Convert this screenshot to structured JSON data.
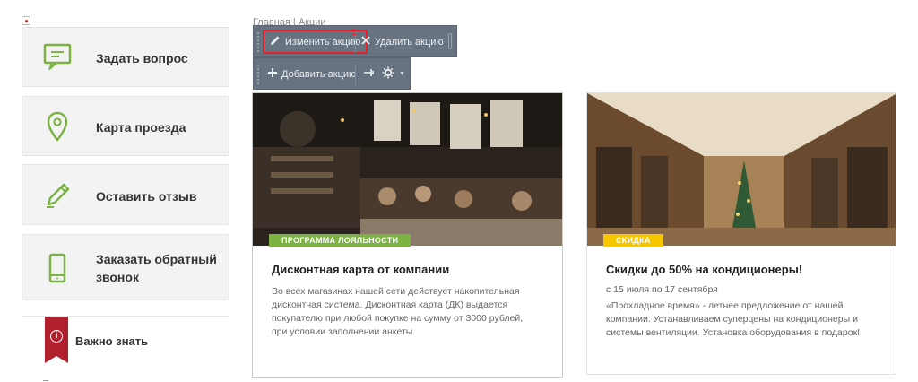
{
  "breadcrumb": "Главная | Акции",
  "sidebar": {
    "items": [
      {
        "label": "Задать вопрос",
        "icon": "chat-bubble-icon"
      },
      {
        "label": "Карта проезда",
        "icon": "map-pin-icon"
      },
      {
        "label": "Оставить отзыв",
        "icon": "pencil-icon"
      },
      {
        "label": "Заказать обратный звонок",
        "icon": "phone-icon"
      }
    ],
    "important_label": "Важно знать",
    "icon_color": "#7cb342",
    "ribbon_color": "#b21f2d"
  },
  "toolbar": {
    "edit_label": "Изменить акцию",
    "delete_label": "Удалить акцию",
    "add_label": "Добавить акцию",
    "marker": "1"
  },
  "cards": [
    {
      "tag": "ПРОГРАММА ЛОЯЛЬНОСТИ",
      "tag_color": "#7cb342",
      "title": "Дисконтная карта от компании",
      "text": "Во всех магазинах нашей сети действует накопительная дисконтная система. Дисконтная карта (ДК) выдается покупателю при любой покупке на сумму от 3000 рублей, при условии заполнении анкеты."
    },
    {
      "tag": "СКИДКА",
      "tag_color": "#f6c700",
      "title": "Скидки до 50% на кондиционеры!",
      "date": "с 15 июля по 17 сентября",
      "text": "«Прохладное время» - летнее предложение от нашей компании. Устанавливаем суперцены на кондиционеры и системы вентиляции. Установка оборудования в подарок!"
    }
  ]
}
